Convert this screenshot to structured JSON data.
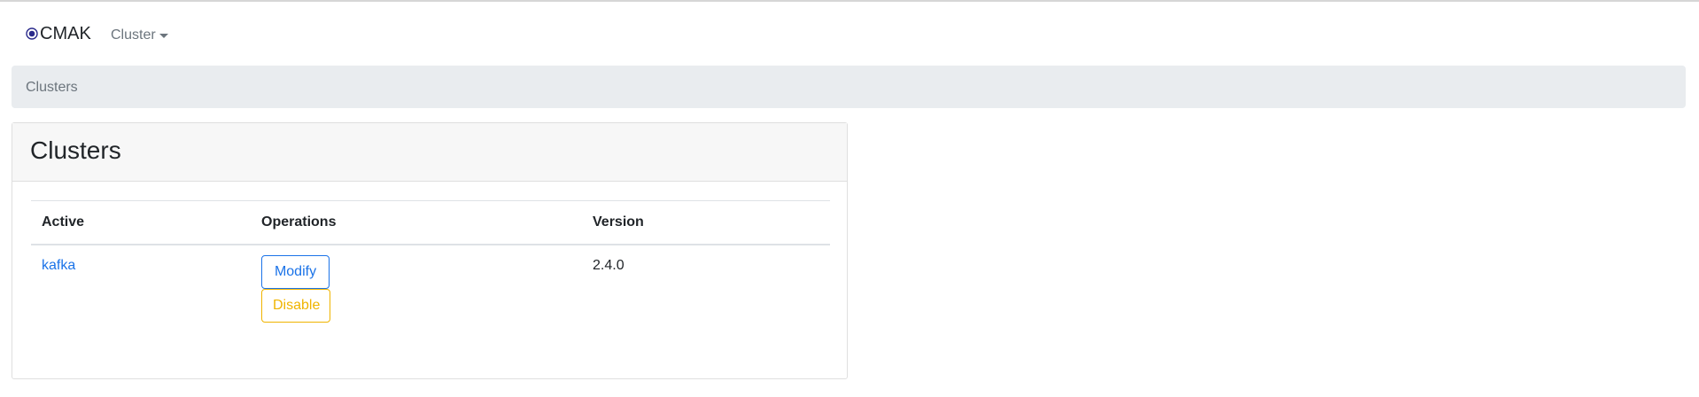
{
  "navbar": {
    "brand": "CMAK",
    "brand_icon": "target-icon",
    "cluster_menu_label": "Cluster"
  },
  "breadcrumb": {
    "items": [
      "Clusters"
    ]
  },
  "card": {
    "title": "Clusters",
    "table": {
      "headers": [
        "Active",
        "Operations",
        "Version"
      ],
      "rows": [
        {
          "name": "kafka",
          "operations": [
            "Modify",
            "Disable"
          ],
          "version": "2.4.0"
        }
      ]
    }
  },
  "colors": {
    "link": "#1b73e8",
    "modify_button": "#1b73e8",
    "disable_button": "#f0b400",
    "breadcrumb_bg": "#e9ecef",
    "card_header_bg": "#f7f7f7"
  }
}
